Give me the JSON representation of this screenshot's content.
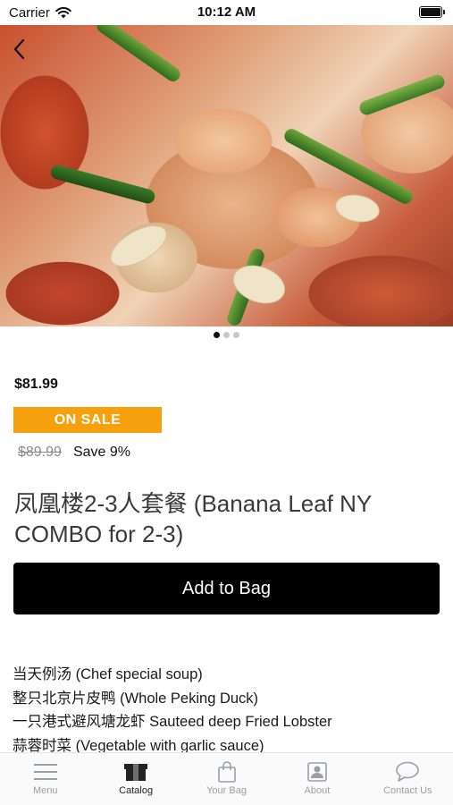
{
  "status_bar": {
    "carrier": "Carrier",
    "time": "10:12 AM"
  },
  "product": {
    "price": "$81.99",
    "sale_badge": "ON SALE",
    "compare_price": "$89.99",
    "save_text": "Save 9%",
    "title": "凤凰楼2-3人套餐 (Banana Leaf NY COMBO for 2-3)",
    "add_button_label": "Add to Bag",
    "description_lines": [
      "当天例汤 (Chef special soup)",
      "整只北京片皮鸭 (Whole Peking Duck)",
      "一只港式避风塘龙虾 Sauteed deep Fried Lobster",
      "蒜蓉时菜 (Vegetable with garlic sauce)"
    ]
  },
  "carousel": {
    "page_count": 3,
    "active_index": 0
  },
  "tab_bar": {
    "tabs": [
      {
        "label": "Menu",
        "icon": "hamburger-menu-icon",
        "active": false
      },
      {
        "label": "Catalog",
        "icon": "catalog-box-icon",
        "active": true
      },
      {
        "label": "Your Bag",
        "icon": "shopping-bag-icon",
        "active": false
      },
      {
        "label": "About",
        "icon": "contact-card-icon",
        "active": false
      },
      {
        "label": "Contact Us",
        "icon": "chat-bubble-icon",
        "active": false
      }
    ]
  },
  "colors": {
    "sale_badge": "#f7a00d",
    "button_bg": "#000000",
    "tab_inactive": "#9a9fa6",
    "tab_active": "#222222"
  }
}
